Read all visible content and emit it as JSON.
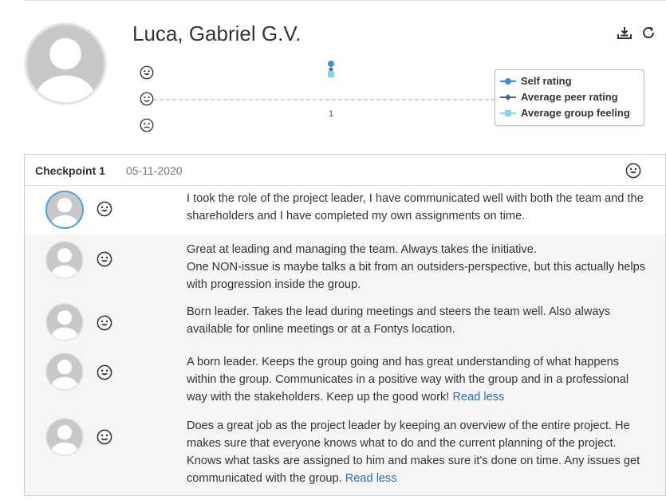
{
  "profile": {
    "name": "Luca, Gabriel G.V.",
    "avatar_icon": "user-placeholder-icon"
  },
  "toolbar": {
    "export_icon": "export-icon",
    "refresh_icon": "refresh-icon"
  },
  "rating_chart": {
    "faces": [
      "happy-face-icon",
      "neutral-face-icon",
      "sad-face-icon"
    ],
    "x_tick_label": "1",
    "legend": {
      "self_rating": "Self rating",
      "average_peer_rating": "Average peer rating",
      "average_group_feeling": "Average group feeling"
    }
  },
  "chart_data": {
    "type": "line",
    "x": [
      "1"
    ],
    "series": [
      {
        "name": "Self rating",
        "values": [
          1
        ],
        "color": "#3b8fd9"
      },
      {
        "name": "Average peer rating",
        "values": [
          1
        ],
        "color": "#5a6470"
      },
      {
        "name": "Average group feeling",
        "values": [
          1
        ],
        "color": "#7fd6ef"
      }
    ],
    "y_scale_icons": [
      "happy-face-icon",
      "neutral-face-icon",
      "sad-face-icon"
    ],
    "legend_position": "right"
  },
  "checkpoint": {
    "title": "Checkpoint 1",
    "date": "05-11-2020",
    "mood_icon": "happy-face-icon",
    "feedback": [
      {
        "mood": "happy-face-icon",
        "text": "I took the role of the project leader, I have communicated well with both the team and the shareholders and I have completed my own assignments on time.",
        "link": ""
      },
      {
        "mood": "happy-face-icon",
        "lines": [
          "Great at leading and managing the team. Always takes the initiative.",
          "One NON-issue is maybe talks a bit from an outsiders-perspective, but this actually helps with progression inside the group."
        ],
        "link": ""
      },
      {
        "mood": "happy-face-icon",
        "text": "Born leader. Takes the lead during meetings and steers the team well. Also always available for online meetings or at a Fontys location.",
        "link": ""
      },
      {
        "mood": "happy-face-icon",
        "text": "A born leader. Keeps the group going and has great understanding of what happens within the group. Communicates in a positive way with the group and in a professional way with the stakeholders. Keep up the good work!",
        "link": "Read less"
      },
      {
        "mood": "neutral-face-icon",
        "text": "Does a great job as the project leader by keeping an overview of the entire project. He makes sure that everyone knows what to do and the current planning of the project. Knows what tasks are assigned to him and makes sure it's done on time. Any issues get communicated with the group.",
        "link": "Read less"
      }
    ]
  },
  "colors": {
    "self_rating": "#3b8fd9",
    "average_peer_rating": "#5a6470",
    "average_group_feeling": "#7fd6ef",
    "link": "#2a6eb0",
    "highlight_ring": "#4aa3df"
  }
}
